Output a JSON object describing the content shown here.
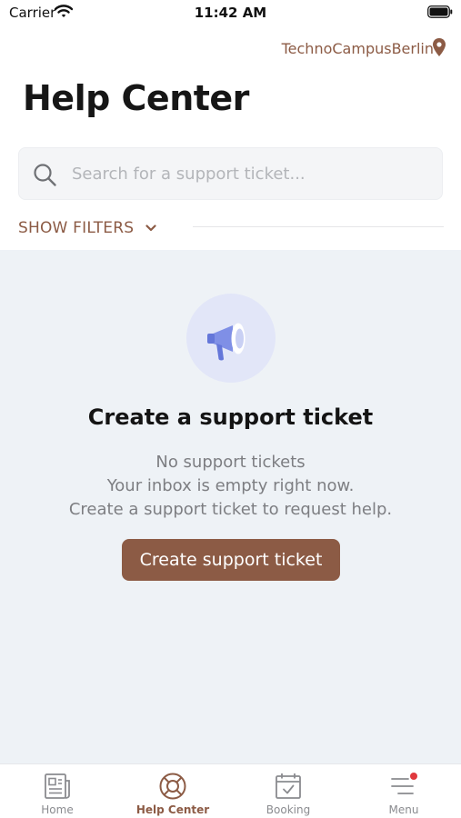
{
  "status_bar": {
    "carrier": "Carrier",
    "time": "11:42 AM"
  },
  "header": {
    "location": "TechnoCampusBerlin",
    "title": "Help Center"
  },
  "search": {
    "placeholder": "Search for a support ticket...",
    "value": ""
  },
  "filters": {
    "label": "SHOW FILTERS"
  },
  "empty_state": {
    "title": "Create a support ticket",
    "line1": "No support tickets",
    "line2": "Your inbox is empty right now.",
    "line3": "Create a support ticket to request help.",
    "button_label": "Create support ticket"
  },
  "tab_bar": {
    "active": "Help Center",
    "tabs": [
      {
        "label": "Home",
        "icon": "newspaper-icon"
      },
      {
        "label": "Help Center",
        "icon": "lifebuoy-icon"
      },
      {
        "label": "Booking",
        "icon": "calendar-check-icon"
      },
      {
        "label": "Menu",
        "icon": "menu-icon"
      }
    ],
    "menu_badge": true
  },
  "colors": {
    "accent": "#8c5b45",
    "content_background": "#eef2f6",
    "illustration_background": "#e2e6f8",
    "megaphone": "#7f8fe6",
    "badge": "#e0393e"
  }
}
